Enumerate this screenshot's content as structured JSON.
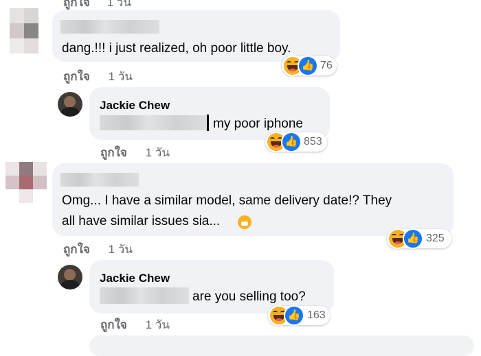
{
  "comments": [
    {
      "text": "dang.!!! i just realized, oh poor little boy.",
      "like_label": "ถูกใจ",
      "time": "1 วัน",
      "reaction_count": "76",
      "reply": {
        "author": "Jackie Chew",
        "text": "my poor iphone",
        "like_label": "ถูกใจ",
        "time": "1 วัน",
        "reaction_count": "853"
      }
    },
    {
      "text_line1": "Omg... I have a similar model, same delivery date!? They",
      "text_line2": "all have similar issues sia...",
      "like_label": "ถูกใจ",
      "time": "1 วัน",
      "reaction_count": "325",
      "reply": {
        "author": "Jackie Chew",
        "text": "are you selling too?",
        "like_label": "ถูกใจ",
        "time": "1 วัน",
        "reaction_count": "163"
      }
    }
  ],
  "top_partial": {
    "like_label": "ถูกใจ",
    "time": "1 วัน"
  },
  "icons": {
    "haha": "haha-reaction-icon",
    "like": "like-reaction-icon"
  },
  "colors": {
    "bubble": "#f0f2f5",
    "meta": "#65676b",
    "like_blue": "#1877f2",
    "haha_yellow": "#f7b125"
  }
}
